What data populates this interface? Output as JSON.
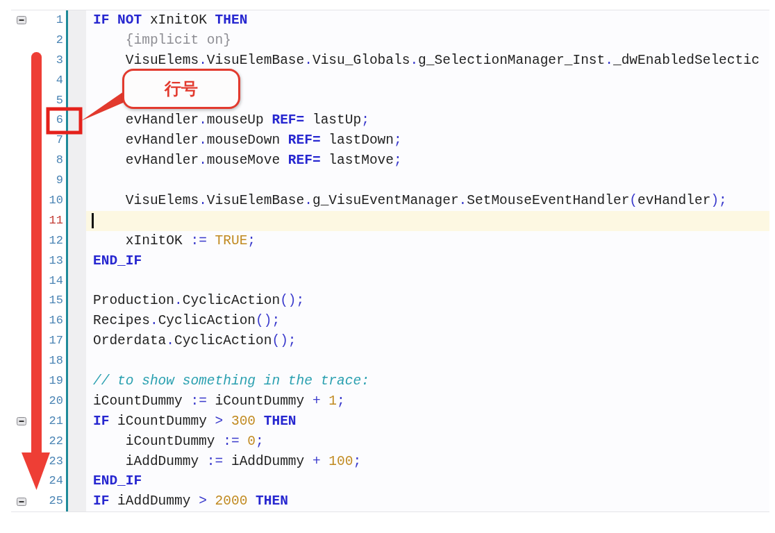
{
  "editor": {
    "lines": [
      {
        "number": "1",
        "foldable": true,
        "current": false,
        "tokens": [
          {
            "kind": "kw",
            "text": "IF"
          },
          {
            "kind": "kw",
            "text": " NOT"
          },
          {
            "kind": "id",
            "text": " xInitOK"
          },
          {
            "kind": "kw",
            "text": " THEN"
          }
        ]
      },
      {
        "number": "2",
        "foldable": false,
        "current": false,
        "tokens": [
          {
            "kind": "pragma",
            "text": "    {implicit on}"
          }
        ]
      },
      {
        "number": "3",
        "foldable": false,
        "current": false,
        "tokens": [
          {
            "kind": "id",
            "text": "    VisuElems"
          },
          {
            "kind": "member",
            "text": ".VisuElemBase"
          },
          {
            "kind": "member",
            "text": ".Visu_Globals"
          },
          {
            "kind": "member",
            "text": ".g_SelectionManager_Inst"
          },
          {
            "kind": "member",
            "text": "._dwEnabledSelectic"
          }
        ]
      },
      {
        "number": "4",
        "foldable": false,
        "current": false
      },
      {
        "number": "5",
        "foldable": false,
        "current": false
      },
      {
        "number": "6",
        "foldable": false,
        "current": false,
        "tokens": [
          {
            "kind": "id",
            "text": "    evHandler"
          },
          {
            "kind": "member",
            "text": ".mouseUp "
          },
          {
            "kind": "kw",
            "text": "REF="
          },
          {
            "kind": "id",
            "text": " lastUp"
          },
          {
            "kind": "op",
            "text": ";"
          }
        ]
      },
      {
        "number": "7",
        "foldable": false,
        "current": false,
        "tokens": [
          {
            "kind": "id",
            "text": "    evHandler"
          },
          {
            "kind": "member",
            "text": ".mouseDown "
          },
          {
            "kind": "kw",
            "text": "REF="
          },
          {
            "kind": "id",
            "text": " lastDown"
          },
          {
            "kind": "op",
            "text": ";"
          }
        ]
      },
      {
        "number": "8",
        "foldable": false,
        "current": false,
        "tokens": [
          {
            "kind": "id",
            "text": "    evHandler"
          },
          {
            "kind": "member",
            "text": ".mouseMove "
          },
          {
            "kind": "kw",
            "text": "REF="
          },
          {
            "kind": "id",
            "text": " lastMove"
          },
          {
            "kind": "op",
            "text": ";"
          }
        ]
      },
      {
        "number": "9",
        "foldable": false,
        "current": false
      },
      {
        "number": "10",
        "foldable": false,
        "current": false,
        "tokens": [
          {
            "kind": "id",
            "text": "    VisuElems"
          },
          {
            "kind": "member",
            "text": ".VisuElemBase"
          },
          {
            "kind": "member",
            "text": ".g_VisuEventManager"
          },
          {
            "kind": "member",
            "text": ".SetMouseEventHandler"
          },
          {
            "kind": "op",
            "text": "("
          },
          {
            "kind": "id",
            "text": "evHandler"
          },
          {
            "kind": "op",
            "text": ");"
          }
        ]
      },
      {
        "number": "11",
        "foldable": false,
        "current": true
      },
      {
        "number": "12",
        "foldable": false,
        "current": false,
        "tokens": [
          {
            "kind": "id",
            "text": "    xInitOK "
          },
          {
            "kind": "op",
            "text": ":="
          },
          {
            "kind": "num",
            "text": " TRUE"
          },
          {
            "kind": "op",
            "text": ";"
          }
        ]
      },
      {
        "number": "13",
        "foldable": false,
        "current": false,
        "tokens": [
          {
            "kind": "kw",
            "text": "END_IF"
          }
        ]
      },
      {
        "number": "14",
        "foldable": false,
        "current": false
      },
      {
        "number": "15",
        "foldable": false,
        "current": false,
        "tokens": [
          {
            "kind": "id",
            "text": "Production"
          },
          {
            "kind": "member",
            "text": ".CyclicAction"
          },
          {
            "kind": "op",
            "text": "();"
          }
        ]
      },
      {
        "number": "16",
        "foldable": false,
        "current": false,
        "tokens": [
          {
            "kind": "id",
            "text": "Recipes"
          },
          {
            "kind": "member",
            "text": ".CyclicAction"
          },
          {
            "kind": "op",
            "text": "();"
          }
        ]
      },
      {
        "number": "17",
        "foldable": false,
        "current": false,
        "tokens": [
          {
            "kind": "id",
            "text": "Orderdata"
          },
          {
            "kind": "member",
            "text": ".CyclicAction"
          },
          {
            "kind": "op",
            "text": "();"
          }
        ]
      },
      {
        "number": "18",
        "foldable": false,
        "current": false
      },
      {
        "number": "19",
        "foldable": false,
        "current": false,
        "tokens": [
          {
            "kind": "comment",
            "text": "// to show something in the trace:"
          }
        ]
      },
      {
        "number": "20",
        "foldable": false,
        "current": false,
        "tokens": [
          {
            "kind": "id",
            "text": "iCountDummy "
          },
          {
            "kind": "op",
            "text": ":="
          },
          {
            "kind": "id",
            "text": " iCountDummy "
          },
          {
            "kind": "op",
            "text": "+"
          },
          {
            "kind": "num",
            "text": " 1"
          },
          {
            "kind": "op",
            "text": ";"
          }
        ]
      },
      {
        "number": "21",
        "foldable": true,
        "current": false,
        "tokens": [
          {
            "kind": "kw",
            "text": "IF"
          },
          {
            "kind": "id",
            "text": " iCountDummy "
          },
          {
            "kind": "op",
            "text": ">"
          },
          {
            "kind": "num",
            "text": " 300"
          },
          {
            "kind": "kw",
            "text": " THEN"
          }
        ]
      },
      {
        "number": "22",
        "foldable": false,
        "current": false,
        "tokens": [
          {
            "kind": "id",
            "text": "    iCountDummy "
          },
          {
            "kind": "op",
            "text": ":="
          },
          {
            "kind": "num",
            "text": " 0"
          },
          {
            "kind": "op",
            "text": ";"
          }
        ]
      },
      {
        "number": "23",
        "foldable": false,
        "current": false,
        "tokens": [
          {
            "kind": "id",
            "text": "    iAddDummy "
          },
          {
            "kind": "op",
            "text": ":="
          },
          {
            "kind": "id",
            "text": " iAddDummy "
          },
          {
            "kind": "op",
            "text": "+"
          },
          {
            "kind": "num",
            "text": " 100"
          },
          {
            "kind": "op",
            "text": ";"
          }
        ]
      },
      {
        "number": "24",
        "foldable": false,
        "current": false,
        "tokens": [
          {
            "kind": "kw",
            "text": "END_IF"
          }
        ]
      },
      {
        "number": "25",
        "foldable": true,
        "current": false,
        "tokens": [
          {
            "kind": "kw",
            "text": "IF"
          },
          {
            "kind": "id",
            "text": " iAddDummy "
          },
          {
            "kind": "op",
            "text": ">"
          },
          {
            "kind": "num",
            "text": " 2000"
          },
          {
            "kind": "kw",
            "text": " THEN"
          }
        ]
      }
    ]
  },
  "annotations": [
    {
      "kind": "arrow"
    },
    {
      "kind": "highlight_box"
    },
    {
      "kind": "callout",
      "label": "行号"
    }
  ]
}
